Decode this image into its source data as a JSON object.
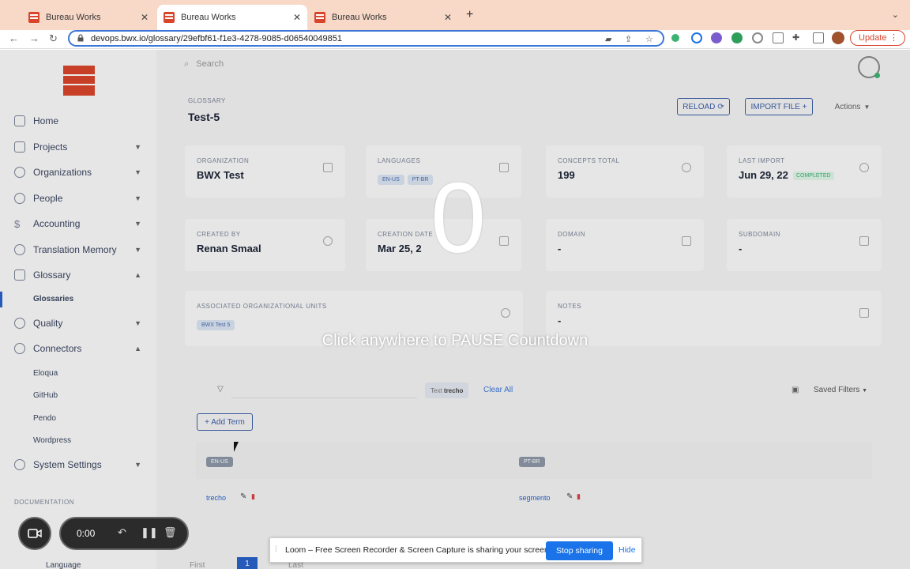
{
  "browser": {
    "tabs": [
      {
        "title": "Bureau Works",
        "active": false
      },
      {
        "title": "Bureau Works",
        "active": true
      },
      {
        "title": "Bureau Works",
        "active": false
      }
    ],
    "url": "devops.bwx.io/glossary/29efbf61-f1e3-4278-9085-d06540049851",
    "update_label": "Update"
  },
  "search": {
    "placeholder": "Search"
  },
  "sidebar": {
    "items": [
      {
        "label": "Home"
      },
      {
        "label": "Projects"
      },
      {
        "label": "Organizations"
      },
      {
        "label": "People"
      },
      {
        "label": "Accounting"
      },
      {
        "label": "Translation Memory"
      },
      {
        "label": "Glossary"
      },
      {
        "label": "Quality"
      },
      {
        "label": "Connectors"
      },
      {
        "label": "System Settings"
      }
    ],
    "glossary_sub": "Glossaries",
    "connectors_sub": [
      "Eloqua",
      "GitHub",
      "Pendo",
      "Wordpress"
    ],
    "documentation": "DOCUMENTATION",
    "language": "Language"
  },
  "page": {
    "breadcrumb": "GLOSSARY",
    "title": "Test-5",
    "reload": "RELOAD",
    "import_file": "IMPORT FILE +",
    "actions": "Actions"
  },
  "cards": {
    "organization": {
      "label": "ORGANIZATION",
      "value": "BWX Test"
    },
    "languages": {
      "label": "LANGUAGES",
      "chips": [
        "EN-US",
        "PT-BR"
      ]
    },
    "concepts": {
      "label": "CONCEPTS TOTAL",
      "value": "199"
    },
    "last_import": {
      "label": "LAST IMPORT",
      "value": "Jun 29, 22",
      "status": "COMPLETED"
    },
    "created_by": {
      "label": "CREATED BY",
      "value": "Renan Smaal"
    },
    "creation_date": {
      "label": "CREATION DATE",
      "value": "Mar 25, 2"
    },
    "domain": {
      "label": "DOMAIN",
      "value": "-"
    },
    "subdomain": {
      "label": "SUBDOMAIN",
      "value": "-"
    },
    "units": {
      "label": "ASSOCIATED ORGANIZATIONAL UNITS",
      "chip": "BWX Test 5"
    },
    "notes": {
      "label": "NOTES",
      "value": "-"
    }
  },
  "filters": {
    "chip_prefix": "Text",
    "chip_value": "trecho",
    "clear_all": "Clear All",
    "saved_filters": "Saved Filters"
  },
  "terms": {
    "add_term": "+ Add Term",
    "lang_left": "EN-US",
    "lang_right": "PT-BR",
    "term_left": "trecho",
    "term_right": "segmento"
  },
  "pagination": {
    "first": "First",
    "current": "1",
    "last": "Last"
  },
  "overlay": {
    "countdown": "0",
    "hint": "Click anywhere to PAUSE Countdown"
  },
  "recorder": {
    "time": "0:00"
  },
  "loom_banner": {
    "text": "Loom – Free Screen Recorder & Screen Capture is sharing your screen.",
    "stop": "Stop sharing",
    "hide": "Hide"
  }
}
